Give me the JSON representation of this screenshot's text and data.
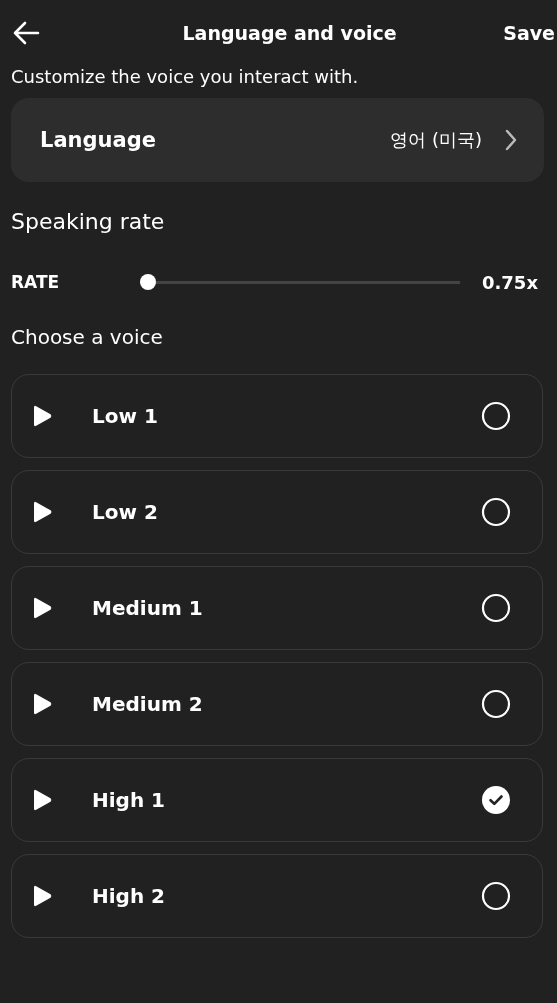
{
  "header": {
    "title": "Language and voice",
    "action": "Save"
  },
  "description": "Customize the voice you interact with.",
  "language": {
    "label": "Language",
    "value": "영어 (미국)"
  },
  "speaking_rate": {
    "heading": "Speaking rate",
    "label": "RATE",
    "level": 0,
    "reading": "0.75x"
  },
  "voices_heading": "Choose a voice",
  "voices": [
    {
      "name": "Low 1",
      "selected": false
    },
    {
      "name": "Low 2",
      "selected": false
    },
    {
      "name": "Medium 1",
      "selected": false
    },
    {
      "name": "Medium 2",
      "selected": false
    },
    {
      "name": "High 1",
      "selected": true
    },
    {
      "name": "High 2",
      "selected": false
    }
  ]
}
